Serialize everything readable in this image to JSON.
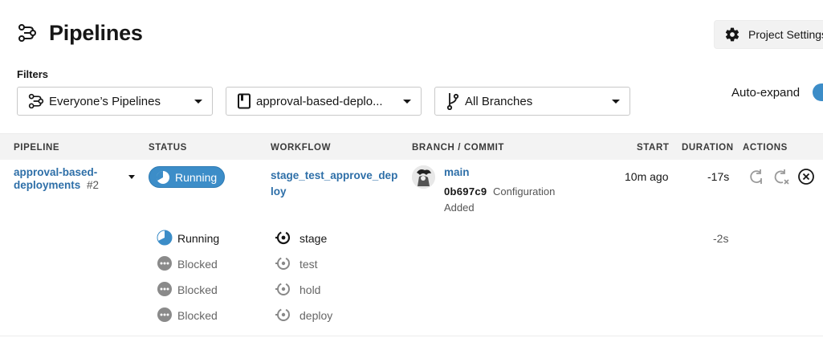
{
  "header": {
    "title": "Pipelines",
    "title_icon": "pipelines-icon",
    "project_settings_label": "Project Settings",
    "project_settings_icon": "gear-icon"
  },
  "filters": {
    "label": "Filters",
    "pipelines_select": "Everyone’s Pipelines",
    "project_select": "approval-based-deplo...",
    "branches_select": "All Branches",
    "auto_expand_label": "Auto-expand",
    "auto_expand_on": true
  },
  "table": {
    "columns": [
      "PIPELINE",
      "STATUS",
      "WORKFLOW",
      "BRANCH / COMMIT",
      "START",
      "DURATION",
      "ACTIONS"
    ],
    "row": {
      "pipeline_name": "approval-based-deployments",
      "pipeline_number": "#2",
      "status": "Running",
      "workflow": "stage_test_approve_deploy",
      "branch": "main",
      "commit_hash": "0b697c9",
      "commit_message": "Configuration Added",
      "start": "10m ago",
      "duration": "-17s"
    },
    "jobs": [
      {
        "status": "Running",
        "name": "stage",
        "duration": "-2s"
      },
      {
        "status": "Blocked",
        "name": "test"
      },
      {
        "status": "Blocked",
        "name": "hold"
      },
      {
        "status": "Blocked",
        "name": "deploy"
      }
    ]
  },
  "colors": {
    "accent": "#3c8dc8",
    "link": "#2e6fa8",
    "blocked": "#8a8a8a"
  }
}
